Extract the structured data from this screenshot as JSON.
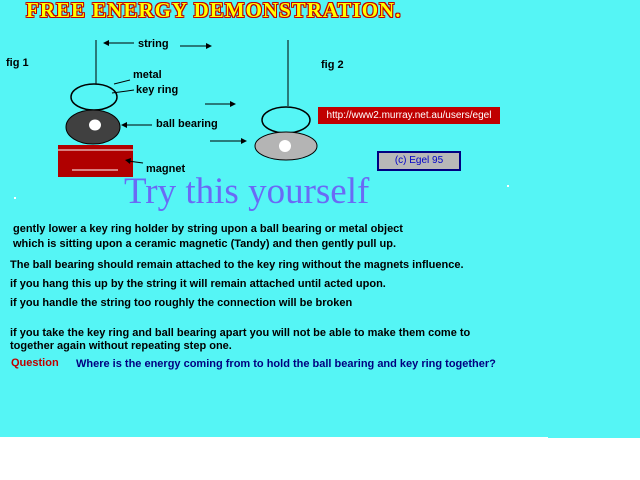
{
  "title": "FREE  ENERGY DEMONSTRATION.",
  "diagram": {
    "fig1_label": "fig 1",
    "fig2_label": "fig 2",
    "string_label": "string",
    "metal_label": "metal",
    "key_ring_label": "key ring",
    "ball_bearing_label": "ball bearing",
    "magnet_label": "magnet"
  },
  "url_text": "http://www2.murray.net.au/users/egel",
  "credit_text": "(c)  Egel  95",
  "headline": "Try this yourself",
  "instructions": [
    "gently lower a key ring holder by string upon a ball bearing or metal object",
    " which is sitting upon a ceramic magnetic (Tandy) and then gently pull up.",
    "The ball bearing should remain attached to the key ring without the magnets influence.",
    "if you hang this up by the string it will remain attached  until   acted upon.",
    "if you handle the string too roughly the connection will be broken",
    "if you take the key ring and ball bearing apart you will not be able to make them come to",
    "together again without repeating step one."
  ],
  "question_label": "Question",
  "question_text": "Where is the energy coming from to hold the ball bearing and key ring together?",
  "colors": {
    "background": "#55f5f5",
    "title_fill": "#ffff00",
    "title_outline": "#c00000",
    "magnet": "#b00000",
    "headline": "#6a6af5",
    "question_label": "#c00000",
    "question_text": "#000080"
  }
}
